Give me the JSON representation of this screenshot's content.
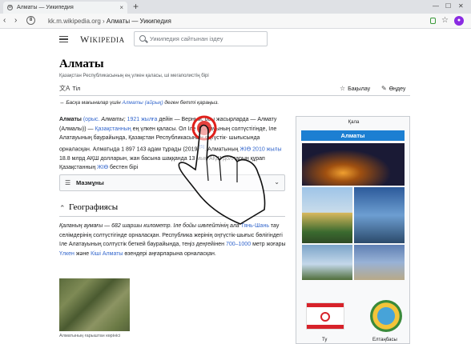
{
  "browser": {
    "tab_title": "Алматы — Уикипедия",
    "tab_close": "×",
    "new_tab": "+",
    "url_host": "kk.m.wikipedia.org",
    "url_sep": " › ",
    "url_page": "Алматы — Уикипедия",
    "shield_label": "8"
  },
  "header": {
    "logo_main": "W",
    "logo_rest": "IKIPEDIA",
    "search_placeholder": "Уикипедия сайтынан іздеу"
  },
  "article": {
    "title": "Алматы",
    "tagline": "Қазақстан Республикасының ең үлкен қаласы, ші мегаполистің бірі",
    "actions": {
      "language": "Тіл",
      "watch": "Бақылау",
      "edit": "Өңдеу"
    },
    "hatnote_prefix": "Басқа мағыналар үшін ",
    "hatnote_link": "Алматы (айрық)",
    "hatnote_suffix": " деген бетті қараңыз.",
    "lead": {
      "bold_name": "Алматы",
      "l1": "(орыс.",
      "l2": "Алматы;",
      "l3": "1921 жылға",
      "l4": "дейін — Верный, осы жасырларда — Алматy",
      "l5": "(Алмалы)) —",
      "l6": "Қазақстанның",
      "l7": "ең үлкен қаласы. Ол Іле Алатауының",
      "l8": "солтүстігінде, Іле Алатауының баурайында, Қазақстан Республикасының оңтүстік-",
      "l9": "шығысында орналасқан. Алматыда 1 897 143 адам тұрады (2019)",
      "l10": "[5]",
      "l11": ". Алматының",
      "l12": "ЖІӨ",
      "l13": "2010 жылы",
      "l14": "18.8 млрд АҚШ долларын, жан басына шаққанда 13 мың АҚШ",
      "l15": "долларын құрап Қазақстанның",
      "l16": "ЖІӨ",
      "l17": "бестен бірі"
    },
    "toc_label": "Мазмұны",
    "section_title": "Географиясы",
    "geo": {
      "g1": "Қаланың аумағы — 682 шаршы километр. Іле бойы шөлейтінің ала",
      "g2": "Тянь-Шань",
      "g3": "тау селімдерінің солтүстігінде орналасқан. Республика жерінің",
      "g4": "оңтүстік-шығыс бөлігіндегі Іле Алатауының солтүстік беткей баурайында, теңіз",
      "g5": "деңгейінен",
      "g6": "700–1000",
      "g7": "метр жоғары",
      "g8": "Үлкен",
      "g9": "және",
      "g10": "Кіші Алматы",
      "g11": "өзендері аңғарларына",
      "g12": "орналасқан."
    },
    "image_caption": "Алматының ғарыштан көрінісі"
  },
  "infobox": {
    "type": "Қала",
    "name": "Алматы",
    "flag_caption": "Ту",
    "emblem_caption": "Елтаңбасы"
  }
}
